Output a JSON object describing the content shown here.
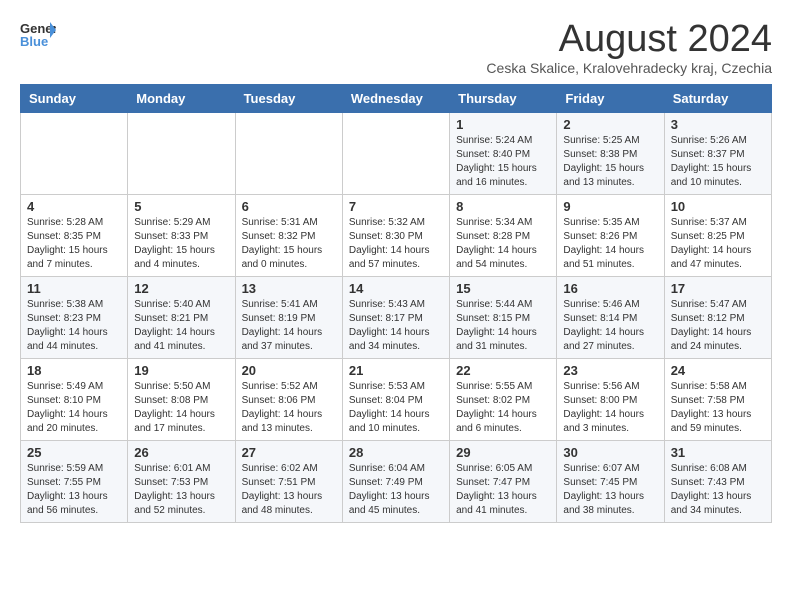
{
  "logo": {
    "line1": "General",
    "line2": "Blue"
  },
  "title": "August 2024",
  "location": "Ceska Skalice, Kralovehradecky kraj, Czechia",
  "weekdays": [
    "Sunday",
    "Monday",
    "Tuesday",
    "Wednesday",
    "Thursday",
    "Friday",
    "Saturday"
  ],
  "weeks": [
    [
      {
        "day": "",
        "info": ""
      },
      {
        "day": "",
        "info": ""
      },
      {
        "day": "",
        "info": ""
      },
      {
        "day": "",
        "info": ""
      },
      {
        "day": "1",
        "info": "Sunrise: 5:24 AM\nSunset: 8:40 PM\nDaylight: 15 hours\nand 16 minutes."
      },
      {
        "day": "2",
        "info": "Sunrise: 5:25 AM\nSunset: 8:38 PM\nDaylight: 15 hours\nand 13 minutes."
      },
      {
        "day": "3",
        "info": "Sunrise: 5:26 AM\nSunset: 8:37 PM\nDaylight: 15 hours\nand 10 minutes."
      }
    ],
    [
      {
        "day": "4",
        "info": "Sunrise: 5:28 AM\nSunset: 8:35 PM\nDaylight: 15 hours\nand 7 minutes."
      },
      {
        "day": "5",
        "info": "Sunrise: 5:29 AM\nSunset: 8:33 PM\nDaylight: 15 hours\nand 4 minutes."
      },
      {
        "day": "6",
        "info": "Sunrise: 5:31 AM\nSunset: 8:32 PM\nDaylight: 15 hours\nand 0 minutes."
      },
      {
        "day": "7",
        "info": "Sunrise: 5:32 AM\nSunset: 8:30 PM\nDaylight: 14 hours\nand 57 minutes."
      },
      {
        "day": "8",
        "info": "Sunrise: 5:34 AM\nSunset: 8:28 PM\nDaylight: 14 hours\nand 54 minutes."
      },
      {
        "day": "9",
        "info": "Sunrise: 5:35 AM\nSunset: 8:26 PM\nDaylight: 14 hours\nand 51 minutes."
      },
      {
        "day": "10",
        "info": "Sunrise: 5:37 AM\nSunset: 8:25 PM\nDaylight: 14 hours\nand 47 minutes."
      }
    ],
    [
      {
        "day": "11",
        "info": "Sunrise: 5:38 AM\nSunset: 8:23 PM\nDaylight: 14 hours\nand 44 minutes."
      },
      {
        "day": "12",
        "info": "Sunrise: 5:40 AM\nSunset: 8:21 PM\nDaylight: 14 hours\nand 41 minutes."
      },
      {
        "day": "13",
        "info": "Sunrise: 5:41 AM\nSunset: 8:19 PM\nDaylight: 14 hours\nand 37 minutes."
      },
      {
        "day": "14",
        "info": "Sunrise: 5:43 AM\nSunset: 8:17 PM\nDaylight: 14 hours\nand 34 minutes."
      },
      {
        "day": "15",
        "info": "Sunrise: 5:44 AM\nSunset: 8:15 PM\nDaylight: 14 hours\nand 31 minutes."
      },
      {
        "day": "16",
        "info": "Sunrise: 5:46 AM\nSunset: 8:14 PM\nDaylight: 14 hours\nand 27 minutes."
      },
      {
        "day": "17",
        "info": "Sunrise: 5:47 AM\nSunset: 8:12 PM\nDaylight: 14 hours\nand 24 minutes."
      }
    ],
    [
      {
        "day": "18",
        "info": "Sunrise: 5:49 AM\nSunset: 8:10 PM\nDaylight: 14 hours\nand 20 minutes."
      },
      {
        "day": "19",
        "info": "Sunrise: 5:50 AM\nSunset: 8:08 PM\nDaylight: 14 hours\nand 17 minutes."
      },
      {
        "day": "20",
        "info": "Sunrise: 5:52 AM\nSunset: 8:06 PM\nDaylight: 14 hours\nand 13 minutes."
      },
      {
        "day": "21",
        "info": "Sunrise: 5:53 AM\nSunset: 8:04 PM\nDaylight: 14 hours\nand 10 minutes."
      },
      {
        "day": "22",
        "info": "Sunrise: 5:55 AM\nSunset: 8:02 PM\nDaylight: 14 hours\nand 6 minutes."
      },
      {
        "day": "23",
        "info": "Sunrise: 5:56 AM\nSunset: 8:00 PM\nDaylight: 14 hours\nand 3 minutes."
      },
      {
        "day": "24",
        "info": "Sunrise: 5:58 AM\nSunset: 7:58 PM\nDaylight: 13 hours\nand 59 minutes."
      }
    ],
    [
      {
        "day": "25",
        "info": "Sunrise: 5:59 AM\nSunset: 7:55 PM\nDaylight: 13 hours\nand 56 minutes."
      },
      {
        "day": "26",
        "info": "Sunrise: 6:01 AM\nSunset: 7:53 PM\nDaylight: 13 hours\nand 52 minutes."
      },
      {
        "day": "27",
        "info": "Sunrise: 6:02 AM\nSunset: 7:51 PM\nDaylight: 13 hours\nand 48 minutes."
      },
      {
        "day": "28",
        "info": "Sunrise: 6:04 AM\nSunset: 7:49 PM\nDaylight: 13 hours\nand 45 minutes."
      },
      {
        "day": "29",
        "info": "Sunrise: 6:05 AM\nSunset: 7:47 PM\nDaylight: 13 hours\nand 41 minutes."
      },
      {
        "day": "30",
        "info": "Sunrise: 6:07 AM\nSunset: 7:45 PM\nDaylight: 13 hours\nand 38 minutes."
      },
      {
        "day": "31",
        "info": "Sunrise: 6:08 AM\nSunset: 7:43 PM\nDaylight: 13 hours\nand 34 minutes."
      }
    ]
  ]
}
